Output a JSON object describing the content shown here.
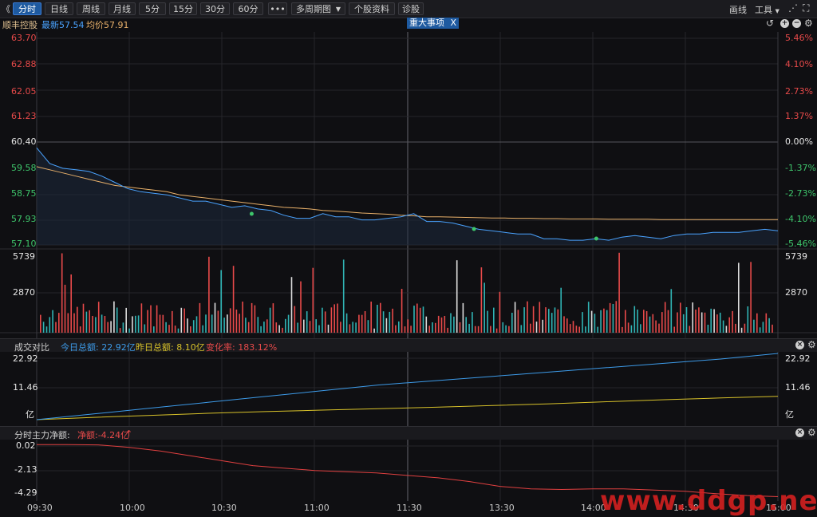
{
  "toolbar": {
    "back_glyph": "《",
    "tabs": [
      "分时",
      "日线",
      "周线",
      "月线",
      "5分",
      "15分",
      "30分",
      "60分"
    ],
    "active_tab": "分时",
    "more": "•••",
    "multi_period": "多周期图",
    "stock_info": "个股资料",
    "diagnose": "诊股",
    "draw": "画线",
    "tools": "工具"
  },
  "info": {
    "name": "顺丰控股",
    "latest_label": "最新57.54",
    "avg_label": "均价57.91",
    "event_tag": "重大事项",
    "event_close": "X"
  },
  "price_axis": {
    "left": [
      "63.70",
      "62.88",
      "62.05",
      "61.23",
      "60.40",
      "59.58",
      "58.75",
      "57.93",
      "57.10"
    ],
    "right": [
      "5.46%",
      "4.10%",
      "2.73%",
      "1.37%",
      "0.00%",
      "-1.37%",
      "-2.73%",
      "-4.10%",
      "-5.46%"
    ]
  },
  "volume_axis": {
    "top": "5739",
    "mid": "2870"
  },
  "turnover": {
    "title": "成交对比",
    "today": "今日总额: 22.92亿",
    "yesterday": "昨日总额: 8.10亿",
    "change": "变化率: 183.12%",
    "axis": [
      "22.92",
      "11.46",
      "亿"
    ]
  },
  "netflow": {
    "title": "分时主力净额:",
    "value": "净额:-4.24亿",
    "arrow": "↑",
    "axis": [
      "0.02",
      "-2.13",
      "-4.29"
    ]
  },
  "time_axis": [
    "09:30",
    "10:00",
    "10:30",
    "11:00",
    "11:30",
    "13:30",
    "14:00",
    "14:30",
    "15:00"
  ],
  "watermark": "www.ddgp.net",
  "colors": {
    "up": "#e84a4a",
    "down": "#3ec56b",
    "price_line": "#4aa3ff",
    "avg_line": "#e8b06a",
    "today_line": "#3d9be9",
    "yesterday_line": "#d8c22a",
    "net_line": "#e04040"
  },
  "chart_data": {
    "type": "line",
    "price": {
      "y_range": [
        57.1,
        63.7
      ],
      "prev_close": 60.4,
      "last": 57.54,
      "avg": 57.91,
      "price": [
        60.2,
        59.7,
        59.55,
        59.5,
        59.45,
        59.3,
        59.1,
        58.9,
        58.8,
        58.75,
        58.7,
        58.6,
        58.5,
        58.5,
        58.4,
        58.3,
        58.35,
        58.25,
        58.2,
        58.05,
        57.95,
        57.95,
        58.1,
        58.0,
        58.0,
        57.9,
        57.9,
        57.95,
        58.0,
        58.1,
        57.85,
        57.85,
        57.8,
        57.7,
        57.6,
        57.55,
        57.5,
        57.45,
        57.45,
        57.3,
        57.3,
        57.25,
        57.25,
        57.3,
        57.25,
        57.35,
        57.4,
        57.35,
        57.3,
        57.4,
        57.45,
        57.45,
        57.5,
        57.5,
        57.5,
        57.55,
        57.6,
        57.55
      ],
      "avg_line": [
        59.6,
        59.5,
        59.4,
        59.3,
        59.2,
        59.1,
        59.0,
        58.95,
        58.9,
        58.85,
        58.8,
        58.7,
        58.65,
        58.6,
        58.55,
        58.5,
        58.45,
        58.4,
        58.35,
        58.3,
        58.28,
        58.25,
        58.2,
        58.18,
        58.15,
        58.12,
        58.1,
        58.08,
        58.05,
        58.03,
        58.0,
        58.0,
        57.99,
        57.98,
        57.97,
        57.96,
        57.96,
        57.95,
        57.95,
        57.94,
        57.94,
        57.93,
        57.93,
        57.93,
        57.92,
        57.92,
        57.92,
        57.92,
        57.91,
        57.91,
        57.91,
        57.91,
        57.91,
        57.91,
        57.91,
        57.91,
        57.91,
        57.91
      ]
    },
    "volume": {
      "y_range": [
        0,
        5739
      ]
    },
    "turnover": {
      "y_range": [
        0,
        22.92
      ],
      "today": [
        0,
        2,
        4,
        6,
        8,
        10,
        12,
        13.5,
        15,
        16.5,
        18,
        19.5,
        21,
        22.92
      ],
      "yesterday": [
        0,
        0.8,
        1.5,
        2.2,
        2.8,
        3.3,
        3.8,
        4.3,
        4.9,
        5.5,
        6.2,
        6.9,
        7.5,
        8.1
      ]
    },
    "netflow": {
      "y_range": [
        -4.6,
        0.3
      ],
      "net": [
        0.02,
        0.02,
        0.0,
        -0.2,
        -0.5,
        -0.9,
        -1.3,
        -1.7,
        -1.9,
        -2.1,
        -2.2,
        -2.3,
        -2.5,
        -2.7,
        -3.0,
        -3.4,
        -3.6,
        -3.65,
        -3.6,
        -3.6,
        -3.7,
        -3.8,
        -4.0,
        -4.15,
        -4.24
      ]
    }
  }
}
